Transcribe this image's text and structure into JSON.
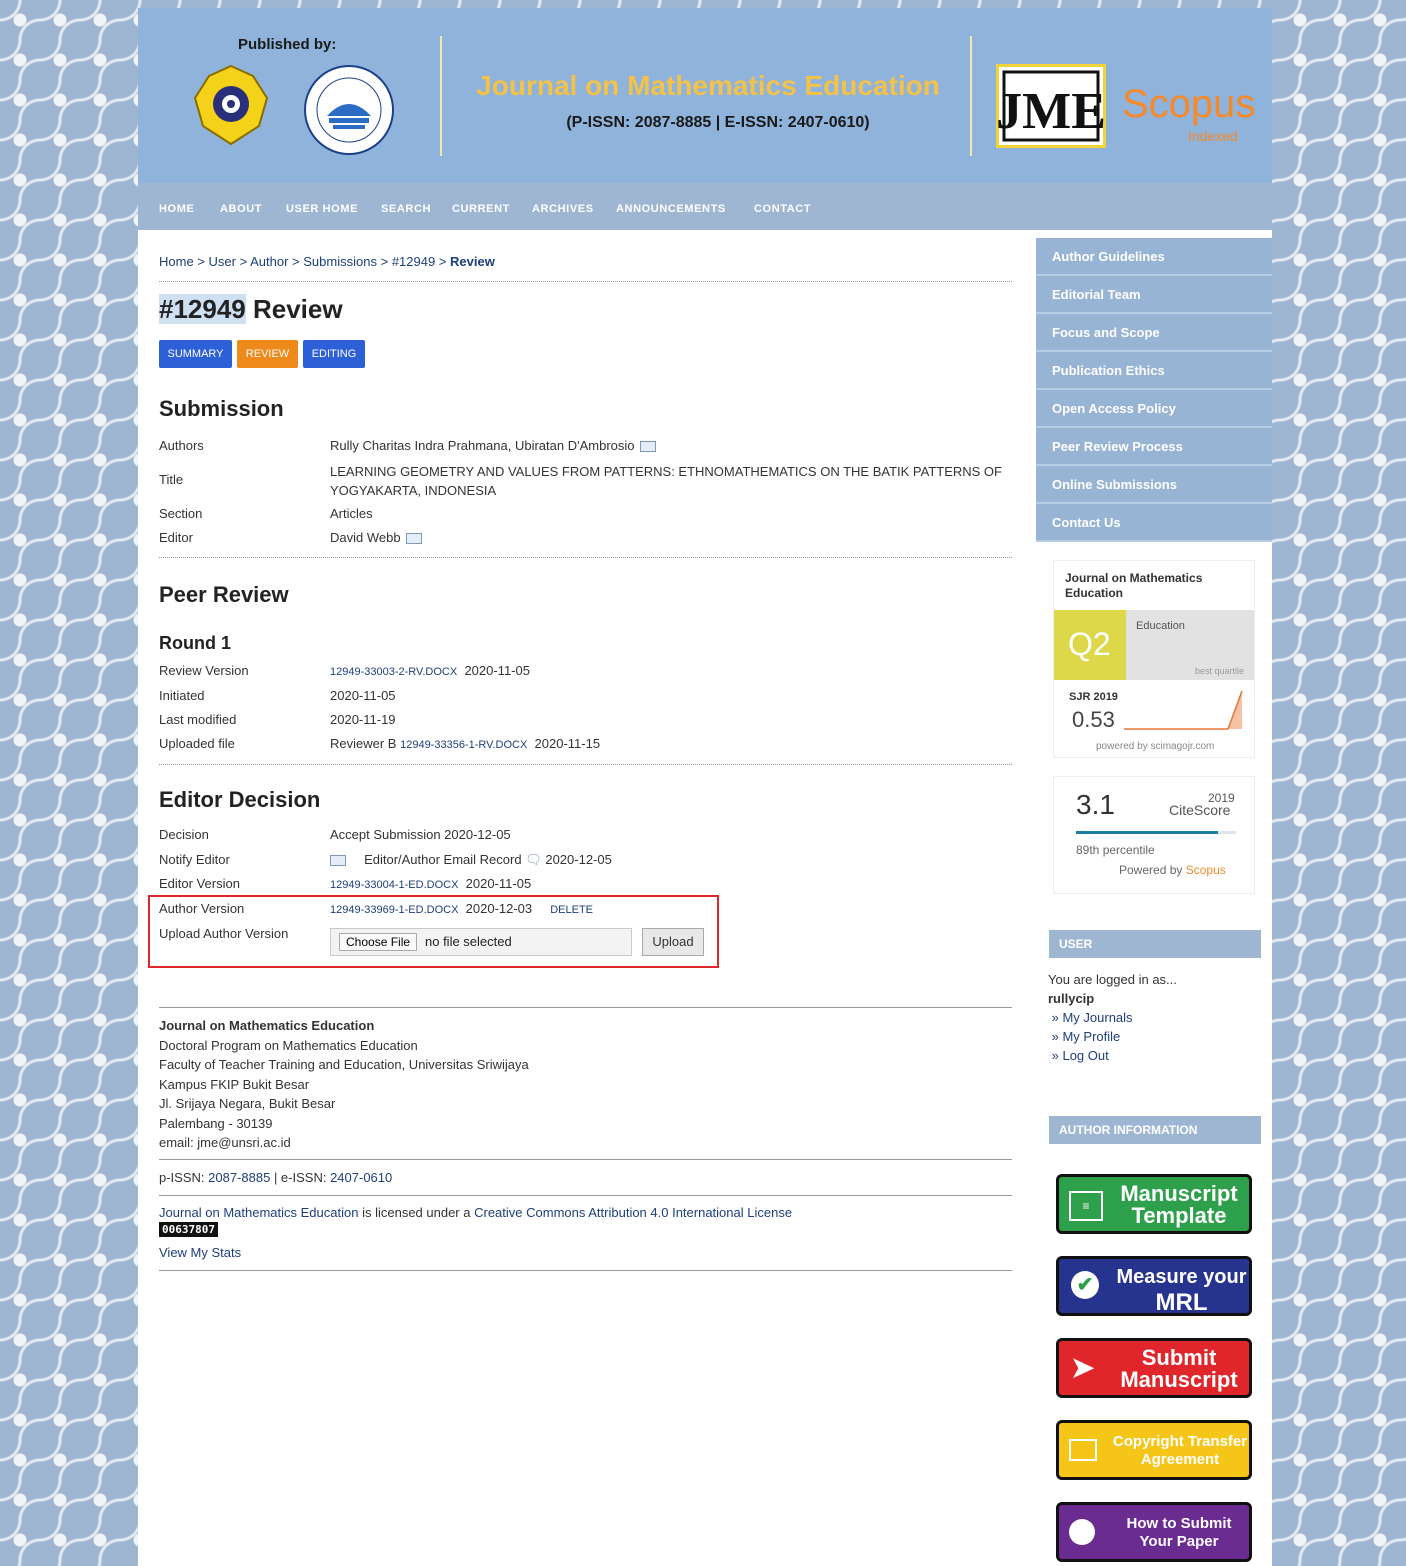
{
  "header": {
    "published_by": "Published by:",
    "journal_title": "Journal on Mathematics Education",
    "issn": "(P-ISSN: 2087-8885 | E-ISSN: 2407-0610)",
    "jme_logo_text": "JME",
    "scopus": "Scopus",
    "scopus_sub": "Indexed"
  },
  "nav": [
    "HOME",
    "ABOUT",
    "USER HOME",
    "SEARCH",
    "CURRENT",
    "ARCHIVES",
    "ANNOUNCEMENTS",
    "CONTACT"
  ],
  "breadcrumb": {
    "home": "Home",
    "user": "User",
    "author": "Author",
    "submissions": "Submissions",
    "id": "#12949",
    "current": "Review",
    "sep": ">"
  },
  "page_title": {
    "id": "#12949",
    "rest": " Review"
  },
  "tabs": {
    "summary": "SUMMARY",
    "review": "REVIEW",
    "editing": "EDITING"
  },
  "submission": {
    "heading": "Submission",
    "authors_label": "Authors",
    "authors": "Rully Charitas Indra Prahmana, Ubiratan D'Ambrosio",
    "title_label": "Title",
    "title": "LEARNING GEOMETRY AND VALUES FROM PATTERNS: ETHNOMATHEMATICS ON THE BATIK PATTERNS OF YOGYAKARTA, INDONESIA",
    "section_label": "Section",
    "section": "Articles",
    "editor_label": "Editor",
    "editor": "David Webb"
  },
  "peer_review": {
    "heading": "Peer Review",
    "round": "Round 1",
    "review_version_label": "Review Version",
    "review_version_file": "12949-33003-2-RV.DOCX",
    "review_version_date": "2020-11-05",
    "initiated_label": "Initiated",
    "initiated": "2020-11-05",
    "last_modified_label": "Last modified",
    "last_modified": "2020-11-19",
    "uploaded_file_label": "Uploaded file",
    "uploaded_reviewer": "Reviewer B",
    "uploaded_file": "12949-33356-1-RV.DOCX",
    "uploaded_date": "2020-11-15"
  },
  "editor_decision": {
    "heading": "Editor Decision",
    "decision_label": "Decision",
    "decision": "Accept Submission 2020-12-05",
    "notify_label": "Notify Editor",
    "notify_record": "Editor/Author Email Record",
    "notify_date": "2020-12-05",
    "editor_version_label": "Editor Version",
    "editor_version_file": "12949-33004-1-ED.DOCX",
    "editor_version_date": "2020-11-05",
    "author_version_label": "Author Version",
    "author_version_file": "12949-33969-1-ED.DOCX",
    "author_version_date": "2020-12-03",
    "delete": "DELETE",
    "upload_label": "Upload Author Version",
    "choose_file": "Choose File",
    "no_file": "no file selected",
    "upload_button": "Upload"
  },
  "footer": {
    "journal": "Journal on Mathematics Education",
    "line1": "Doctoral Program on Mathematics Education",
    "line2": "Faculty of Teacher Training and Education, Universitas Sriwijaya",
    "line3": "Kampus FKIP Bukit Besar",
    "line4": "Jl. Srijaya Negara, Bukit Besar",
    "line5": "Palembang - 30139",
    "line6": "email: jme@unsri.ac.id",
    "pissn_label": "p-ISSN:",
    "pissn": "2087-8885",
    "eissn_sep": "| e-ISSN:",
    "eissn": "2407-0610",
    "license_journal": "Journal on Mathematics Education",
    "license_mid": "is licensed under a",
    "license": "Creative Commons Attribution 4.0 International License",
    "counter": "00637807",
    "stats": "View My Stats"
  },
  "sidebar": {
    "nav": [
      "Author Guidelines",
      "Editorial Team",
      "Focus and Scope",
      "Publication Ethics",
      "Open Access Policy",
      "Peer Review Process",
      "Online Submissions",
      "Contact Us"
    ],
    "sjr": {
      "journal": "Journal on Mathematics Education",
      "quartile": "Q2",
      "category": "Education",
      "best": "best quartile",
      "label": "SJR 2019",
      "value": "0.53",
      "powered": "powered by scimagojr.com"
    },
    "citescore": {
      "value": "3.1",
      "year": "2019",
      "label": "CiteScore",
      "percentile": "89th percentile",
      "powered_by": "Powered by",
      "scopus": "Scopus",
      "percentile_value": 0.89
    },
    "user": {
      "heading": "USER",
      "logged": "You are logged in as...",
      "username": "rullycip",
      "links": [
        "My Journals",
        "My Profile",
        "Log Out"
      ]
    },
    "author_info": "AUTHOR INFORMATION",
    "buttons": {
      "template": [
        "Manuscript",
        "Template"
      ],
      "mrl": [
        "Measure your",
        "MRL"
      ],
      "submit": [
        "Submit",
        "Manuscript"
      ],
      "copyright": [
        "Copyright Transfer",
        "Agreement"
      ],
      "howto": [
        "How to Submit",
        "Your Paper"
      ]
    },
    "colors": {
      "template": "#2e9f4a",
      "mrl": "#26348f",
      "submit": "#e0252b",
      "copyright": "#f5c518",
      "howto": "#6b2c91"
    }
  }
}
